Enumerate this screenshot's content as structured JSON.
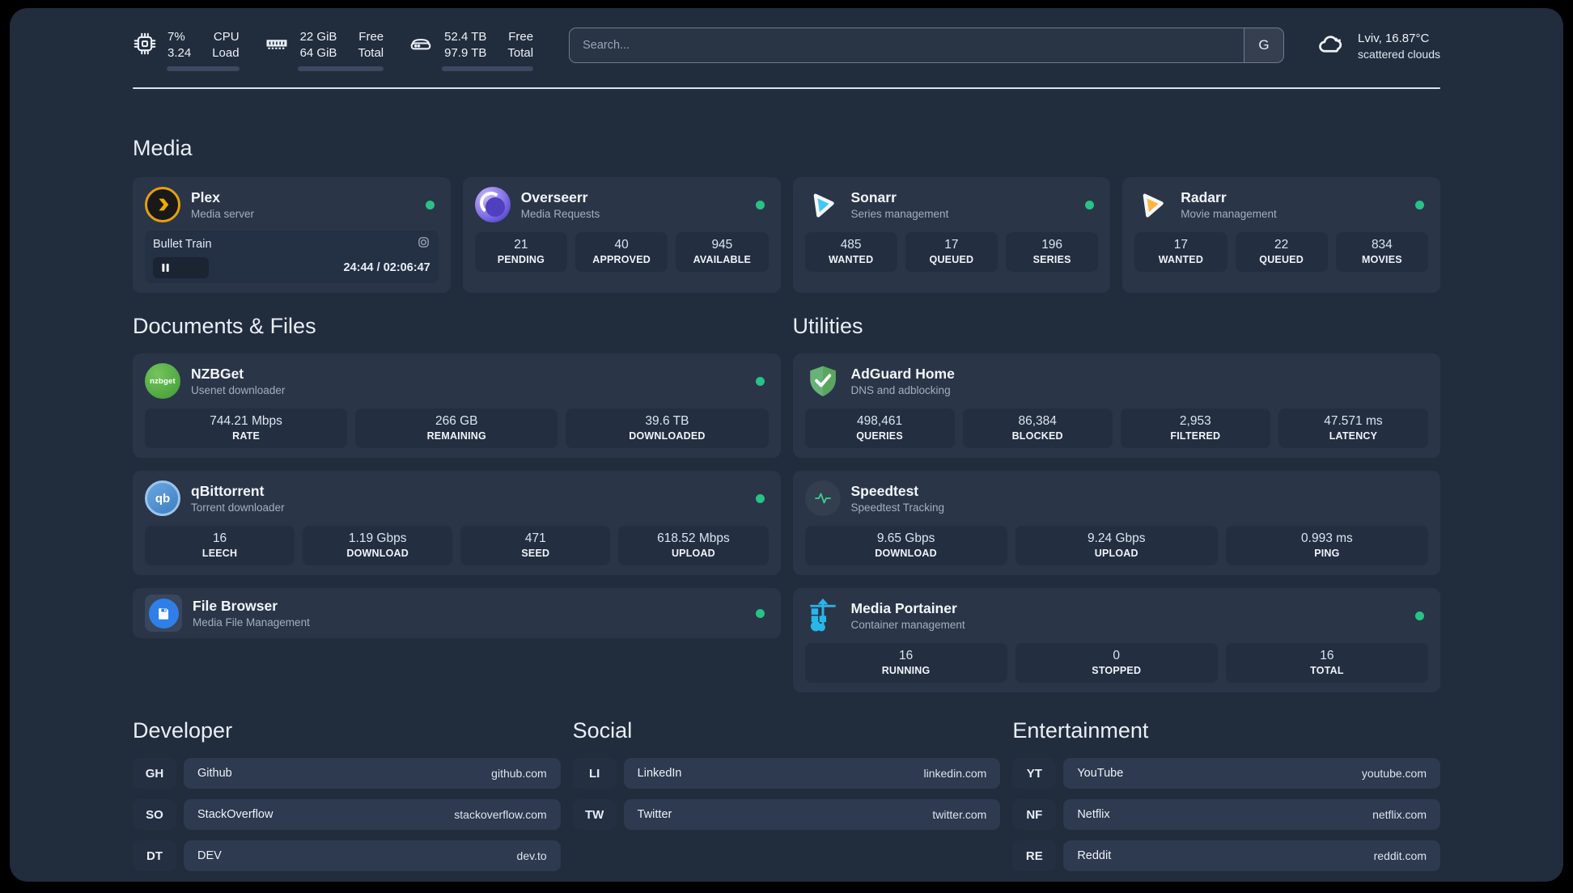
{
  "topbar": {
    "cpu": {
      "value_top": "7%",
      "value_bottom": "3.24",
      "label_top": "CPU",
      "label_bottom": "Load",
      "progress": 7
    },
    "ram": {
      "value_top": "22 GiB",
      "value_bottom": "64 GiB",
      "label_top": "Free",
      "label_bottom": "Total",
      "progress": 65
    },
    "disk": {
      "value_top": "52.4 TB",
      "value_bottom": "97.9 TB",
      "label_top": "Free",
      "label_bottom": "Total",
      "progress": 46
    },
    "search": {
      "placeholder": "Search...",
      "button": "G"
    },
    "weather": {
      "line1": "Lviv, 16.87°C",
      "line2": "scattered clouds"
    }
  },
  "media": {
    "title": "Media",
    "plex": {
      "name": "Plex",
      "desc": "Media server",
      "online": true,
      "now_playing": {
        "title": "Bullet Train",
        "time": "24:44 / 02:06:47",
        "state": "paused",
        "progress_pct": 20
      }
    },
    "overseerr": {
      "name": "Overseerr",
      "desc": "Media Requests",
      "online": true,
      "stats": [
        {
          "value": "21",
          "label": "PENDING"
        },
        {
          "value": "40",
          "label": "APPROVED"
        },
        {
          "value": "945",
          "label": "AVAILABLE"
        }
      ]
    },
    "sonarr": {
      "name": "Sonarr",
      "desc": "Series management",
      "online": true,
      "stats": [
        {
          "value": "485",
          "label": "WANTED"
        },
        {
          "value": "17",
          "label": "QUEUED"
        },
        {
          "value": "196",
          "label": "SERIES"
        }
      ]
    },
    "radarr": {
      "name": "Radarr",
      "desc": "Movie management",
      "online": true,
      "stats": [
        {
          "value": "17",
          "label": "WANTED"
        },
        {
          "value": "22",
          "label": "QUEUED"
        },
        {
          "value": "834",
          "label": "MOVIES"
        }
      ]
    }
  },
  "documents": {
    "title": "Documents & Files",
    "nzbget": {
      "name": "NZBGet",
      "desc": "Usenet downloader",
      "online": true,
      "stats": [
        {
          "value": "744.21 Mbps",
          "label": "RATE"
        },
        {
          "value": "266 GB",
          "label": "REMAINING"
        },
        {
          "value": "39.6 TB",
          "label": "DOWNLOADED"
        }
      ]
    },
    "qbittorrent": {
      "name": "qBittorrent",
      "desc": "Torrent downloader",
      "online": true,
      "stats": [
        {
          "value": "16",
          "label": "LEECH"
        },
        {
          "value": "1.19 Gbps",
          "label": "DOWNLOAD"
        },
        {
          "value": "471",
          "label": "SEED"
        },
        {
          "value": "618.52 Mbps",
          "label": "UPLOAD"
        }
      ]
    },
    "filebrowser": {
      "name": "File Browser",
      "desc": "Media File Management",
      "online": true
    }
  },
  "utilities": {
    "title": "Utilities",
    "adguard": {
      "name": "AdGuard Home",
      "desc": "DNS and adblocking",
      "online": false,
      "stats": [
        {
          "value": "498,461",
          "label": "QUERIES"
        },
        {
          "value": "86,384",
          "label": "BLOCKED"
        },
        {
          "value": "2,953",
          "label": "FILTERED"
        },
        {
          "value": "47.571 ms",
          "label": "LATENCY"
        }
      ]
    },
    "speedtest": {
      "name": "Speedtest",
      "desc": "Speedtest Tracking",
      "online": false,
      "stats": [
        {
          "value": "9.65 Gbps",
          "label": "DOWNLOAD"
        },
        {
          "value": "9.24 Gbps",
          "label": "UPLOAD"
        },
        {
          "value": "0.993 ms",
          "label": "PING"
        }
      ]
    },
    "portainer": {
      "name": "Media Portainer",
      "desc": "Container management",
      "online": true,
      "stats": [
        {
          "value": "16",
          "label": "RUNNING"
        },
        {
          "value": "0",
          "label": "STOPPED"
        },
        {
          "value": "16",
          "label": "TOTAL"
        }
      ]
    }
  },
  "links": {
    "developer": {
      "title": "Developer",
      "items": [
        {
          "abbr": "GH",
          "name": "Github",
          "url": "github.com"
        },
        {
          "abbr": "SO",
          "name": "StackOverflow",
          "url": "stackoverflow.com"
        },
        {
          "abbr": "DT",
          "name": "DEV",
          "url": "dev.to"
        }
      ]
    },
    "social": {
      "title": "Social",
      "items": [
        {
          "abbr": "LI",
          "name": "LinkedIn",
          "url": "linkedin.com"
        },
        {
          "abbr": "TW",
          "name": "Twitter",
          "url": "twitter.com"
        }
      ]
    },
    "entertainment": {
      "title": "Entertainment",
      "items": [
        {
          "abbr": "YT",
          "name": "YouTube",
          "url": "youtube.com"
        },
        {
          "abbr": "NF",
          "name": "Netflix",
          "url": "netflix.com"
        },
        {
          "abbr": "RE",
          "name": "Reddit",
          "url": "reddit.com"
        }
      ]
    }
  },
  "colors": {
    "panel_bg": "#212c3d",
    "card_bg": "#2a3548",
    "stat_bg": "#232e41",
    "status_online": "#27c285",
    "plex_amber": "#e5a00d",
    "sonarr_cyan": "#41c9f4",
    "radarr_amber": "#ffb53e",
    "adguard_green": "#5fae63",
    "portainer_blue": "#29b6ea",
    "speedtest_green": "#3fd08e",
    "progress_fill": "#b9c3d2"
  }
}
